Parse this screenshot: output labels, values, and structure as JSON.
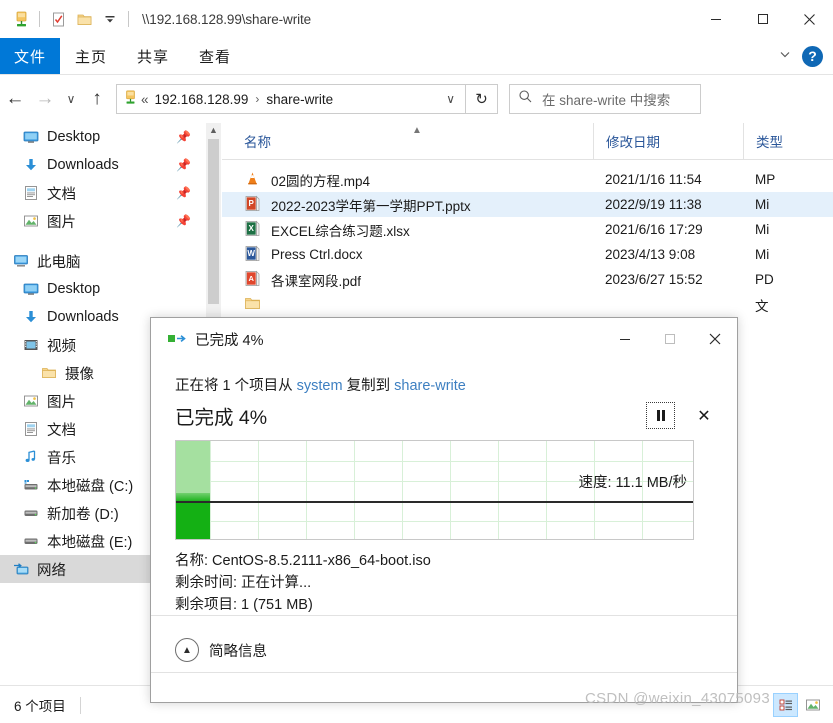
{
  "window": {
    "title": "\\\\192.168.128.99\\share-write",
    "quick_access": [
      "network-folder-icon",
      "properties-icon",
      "new-folder-icon",
      "customize-dropdown-icon"
    ],
    "controls": {
      "minimize": "─",
      "maximize": "□",
      "close": "✕"
    }
  },
  "ribbon": {
    "file_tab": "文件",
    "tabs": [
      "主页",
      "共享",
      "查看"
    ],
    "collapse_icon": "chevron-down-icon",
    "help_label": "?"
  },
  "addressbar": {
    "back_icon": "←",
    "forward_icon": "→",
    "recent_icon": "∨",
    "up_icon": "↑",
    "crumb_lead": "«",
    "crumbs": [
      "192.168.128.99",
      "share-write"
    ],
    "crumb_separator": "›",
    "dropdown_icon": "∨",
    "refresh_icon": "↻"
  },
  "search": {
    "icon": "search-icon",
    "placeholder": "在 share-write 中搜索"
  },
  "navpane": {
    "quick_items": [
      {
        "label": "Desktop",
        "icon": "desktop-icon",
        "pinned": true
      },
      {
        "label": "Downloads",
        "icon": "downloads-icon",
        "pinned": true
      },
      {
        "label": "文档",
        "icon": "documents-icon",
        "pinned": true
      },
      {
        "label": "图片",
        "icon": "pictures-icon",
        "pinned": true
      }
    ],
    "this_pc": {
      "label": "此电脑",
      "icon": "this-pc-icon"
    },
    "pc_items": [
      {
        "label": "Desktop",
        "icon": "desktop-icon",
        "indent": false
      },
      {
        "label": "Downloads",
        "icon": "downloads-icon",
        "indent": false
      },
      {
        "label": "视频",
        "icon": "videos-icon",
        "indent": false
      },
      {
        "label": "摄像",
        "icon": "folder-icon",
        "indent": true
      },
      {
        "label": "图片",
        "icon": "pictures-icon",
        "indent": false
      },
      {
        "label": "文档",
        "icon": "documents-icon",
        "indent": false
      },
      {
        "label": "音乐",
        "icon": "music-icon",
        "indent": false
      },
      {
        "label": "本地磁盘 (C:)",
        "icon": "system-drive-icon",
        "indent": false
      },
      {
        "label": "新加卷 (D:)",
        "icon": "drive-icon",
        "indent": false
      },
      {
        "label": "本地磁盘 (E:)",
        "icon": "drive-icon",
        "indent": false
      }
    ],
    "network": {
      "label": "网络",
      "icon": "network-icon",
      "selected": true
    }
  },
  "filelist": {
    "columns": [
      "名称",
      "修改日期",
      "类型"
    ],
    "sort_indicator": "ascending-caret-icon",
    "rows": [
      {
        "name": "02圆的方程.mp4",
        "date": "2021/1/16 11:54",
        "type": "MP",
        "icon": "vlc-media-icon",
        "selected": false
      },
      {
        "name": "2022-2023学年第一学期PPT.pptx",
        "date": "2022/9/19 11:38",
        "type": "Mi",
        "icon": "powerpoint-icon",
        "selected": true
      },
      {
        "name": "EXCEL综合练习题.xlsx",
        "date": "2021/6/16 17:29",
        "type": "Mi",
        "icon": "excel-icon",
        "selected": false
      },
      {
        "name": "Press Ctrl.docx",
        "date": "2023/4/13 9:08",
        "type": "Mi",
        "icon": "word-icon",
        "selected": false
      },
      {
        "name": "各课室网段.pdf",
        "date": "2023/6/27 15:52",
        "type": "PD",
        "icon": "pdf-icon",
        "selected": false
      },
      {
        "name": "",
        "date": "",
        "type": "文",
        "icon": "folder-icon",
        "selected": false
      }
    ]
  },
  "statusbar": {
    "item_count": "6 个项目",
    "view_details_icon": "details-view-icon",
    "view_large_icon": "large-icons-view-icon"
  },
  "dialog": {
    "title": "已完成 4%",
    "title_icon": "copy-icon",
    "controls": {
      "minimize": "─",
      "maximize": "□",
      "close": "✕"
    },
    "copy_prefix": "正在将 1 个项目从 ",
    "source": "system",
    "copy_mid": " 复制到 ",
    "destination": "share-write",
    "percent_text": "已完成 4%",
    "pause_icon": "pause-icon",
    "cancel_icon": "✕",
    "speed_label": "速度: 11.1 MB/秒",
    "detail_name": "名称: CentOS-8.5.2111-x86_64-boot.iso",
    "detail_time": "剩余时间: 正在计算...",
    "detail_items": "剩余项目: 1 (751 MB)",
    "less_info_label": "简略信息",
    "less_info_icon": "chevron-up-circle-icon"
  },
  "watermark": {
    "text": "CSDN @weixin_43075093"
  },
  "chart_data": {
    "type": "area",
    "title": "Copy speed over time",
    "series": [
      {
        "name": "速度",
        "values": [
          11.1
        ]
      }
    ],
    "annotations": [
      "速度: 11.1 MB/秒"
    ],
    "progress_percent": 4,
    "grid": true,
    "ylabel": "",
    "xlabel": ""
  }
}
